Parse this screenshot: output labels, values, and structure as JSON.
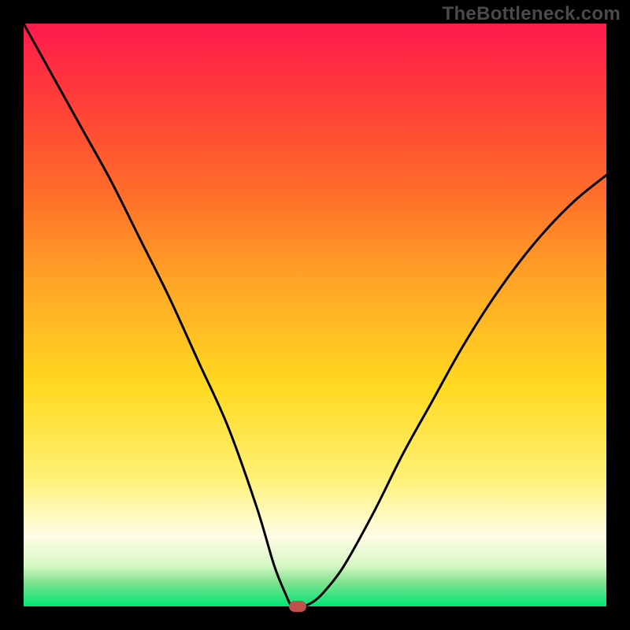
{
  "watermark": "TheBottleneck.com",
  "chart_data": {
    "type": "line",
    "title": "",
    "xlabel": "",
    "ylabel": "",
    "xlim": [
      0,
      100
    ],
    "ylim": [
      0,
      100
    ],
    "series": [
      {
        "name": "bottleneck-curve",
        "x": [
          0,
          5,
          10,
          15,
          20,
          25,
          30,
          35,
          40,
          43,
          45,
          46,
          47,
          48,
          50,
          52,
          55,
          60,
          65,
          70,
          75,
          80,
          85,
          90,
          95,
          100
        ],
        "values": [
          100,
          91,
          82,
          73,
          63,
          53,
          42,
          31,
          17,
          7,
          2,
          0,
          0,
          0,
          1,
          3,
          7,
          16,
          26,
          35,
          44,
          52,
          59,
          65,
          70,
          74
        ]
      }
    ],
    "marker": {
      "x": 47,
      "y": 0
    },
    "gradient_stops": [
      {
        "pos": 0,
        "color": "#ff1a4d"
      },
      {
        "pos": 12,
        "color": "#ff3a3a"
      },
      {
        "pos": 28,
        "color": "#ff6a2a"
      },
      {
        "pos": 45,
        "color": "#ffa726"
      },
      {
        "pos": 62,
        "color": "#ffd91f"
      },
      {
        "pos": 78,
        "color": "#fff176"
      },
      {
        "pos": 88,
        "color": "#fffde7"
      },
      {
        "pos": 93,
        "color": "#d6f7c4"
      },
      {
        "pos": 96,
        "color": "#7de28e"
      },
      {
        "pos": 100,
        "color": "#00e676"
      }
    ]
  }
}
